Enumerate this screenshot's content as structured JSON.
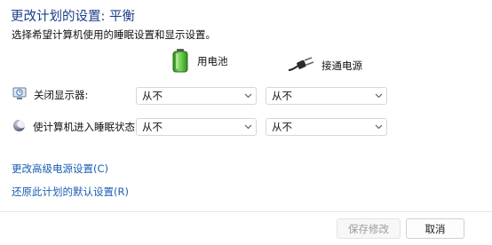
{
  "header": {
    "title": "更改计划的设置: 平衡",
    "subtitle": "选择希望计算机使用的睡眠设置和显示设置。"
  },
  "columns": {
    "on_battery": {
      "label": "用电池",
      "icon": "battery-icon",
      "color": "#45b82f"
    },
    "plugged_in": {
      "label": "接通电源",
      "icon": "power-plug-icon"
    }
  },
  "settings": [
    {
      "label": "关闭显示器:",
      "icon": "display-icon",
      "battery_value": "从不",
      "plugged_value": "从不"
    },
    {
      "label": "使计算机进入睡眠状态:",
      "icon": "sleep-moon-icon",
      "battery_value": "从不",
      "plugged_value": "从不"
    }
  ],
  "links": {
    "advanced": "更改高级电源设置(C)",
    "restore": "还原此计划的默认设置(R)"
  },
  "buttons": {
    "save": "保存修改",
    "cancel": "取消"
  }
}
